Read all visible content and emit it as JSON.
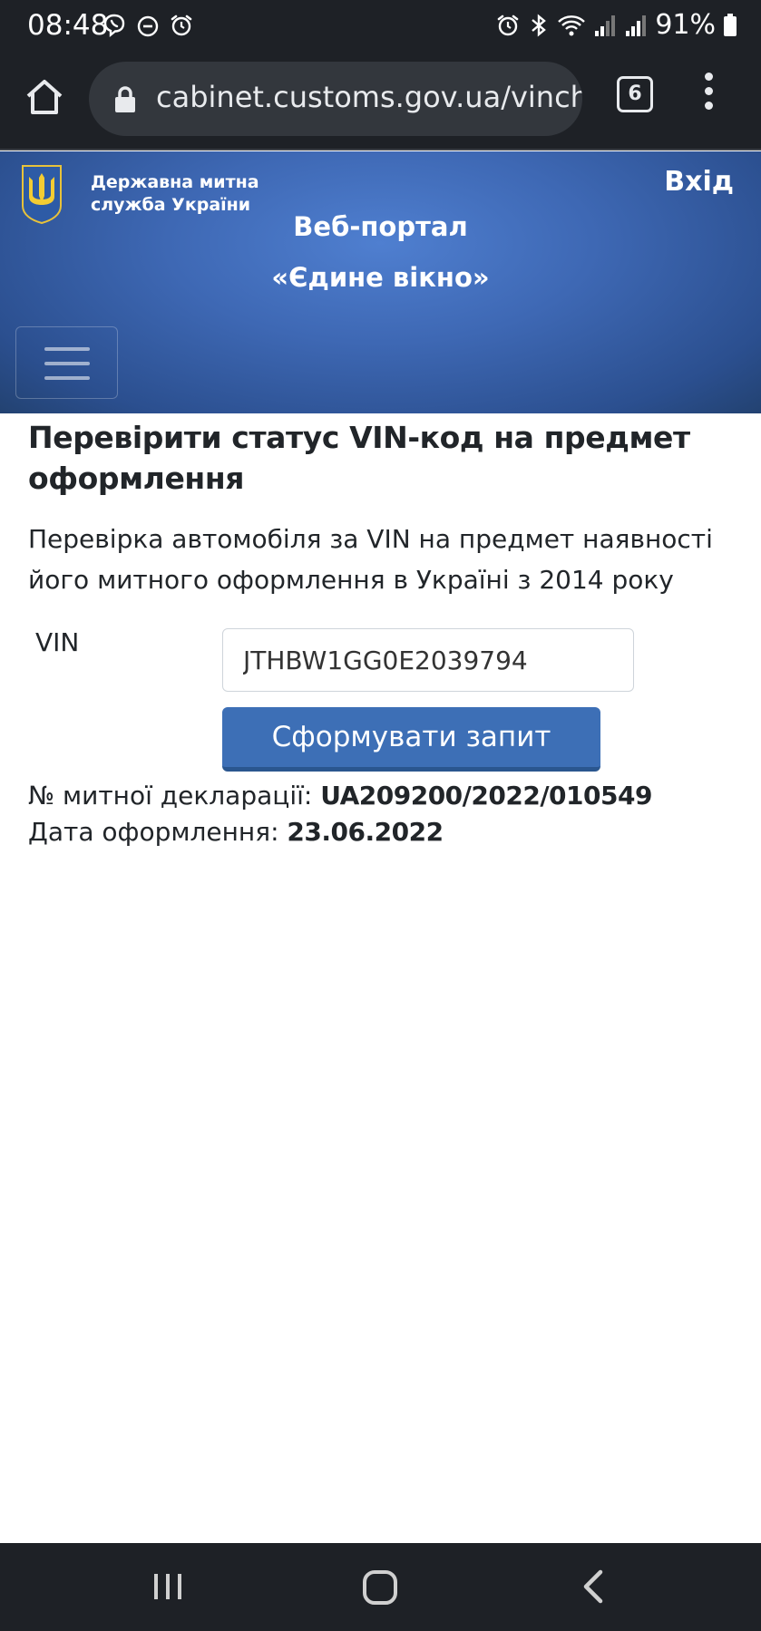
{
  "status_bar": {
    "time": "08:48",
    "battery": "91%",
    "left_icons": [
      "viber-icon",
      "do-not-disturb-icon",
      "alarm-icon"
    ],
    "right_icons": [
      "alarm-icon",
      "bluetooth-icon",
      "wifi-icon",
      "signal-icon",
      "signal-icon",
      "battery-icon"
    ]
  },
  "browser": {
    "url": "cabinet.customs.gov.ua/vincheck",
    "tab_count": "6"
  },
  "header": {
    "agency": "Державна митна служба України",
    "login_label": "Вхід",
    "portal_line1": "Веб-портал",
    "portal_line2": "«Єдине вікно»"
  },
  "page": {
    "title": "Перевірити статус VIN-код на предмет оформлення",
    "description": "Перевірка автомобіля за VIN на предмет наявності його митного оформлення в Україні з 2014 року",
    "vin_label": "VIN",
    "vin_value": "JTHBW1GG0E2039794",
    "submit_label": "Сформувати запит"
  },
  "result": {
    "declaration_label": "№ митної декларації:",
    "declaration_value": "UA209200/2022/010549",
    "date_label": "Дата оформлення:",
    "date_value": "23.06.2022"
  },
  "colors": {
    "header_blue": "#3e68b4",
    "button_blue": "#3d6fb6",
    "system_bar": "#1e2126"
  }
}
